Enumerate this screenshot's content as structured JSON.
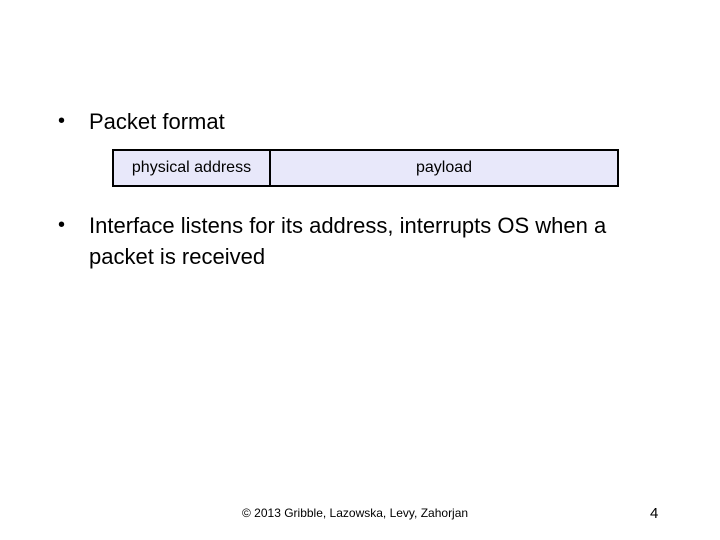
{
  "bullets": [
    {
      "symbol": "•",
      "text": "Packet format"
    },
    {
      "symbol": "•",
      "text": "Interface listens for its address, interrupts OS when a packet is received"
    }
  ],
  "packet_format": {
    "fields": [
      "physical address",
      "payload"
    ],
    "fill_color": "#e8e8fa",
    "border_color": "#000000"
  },
  "footer": {
    "copyright": "© 2013 Gribble, Lazowska, Levy, Zahorjan",
    "page_number": "4"
  }
}
